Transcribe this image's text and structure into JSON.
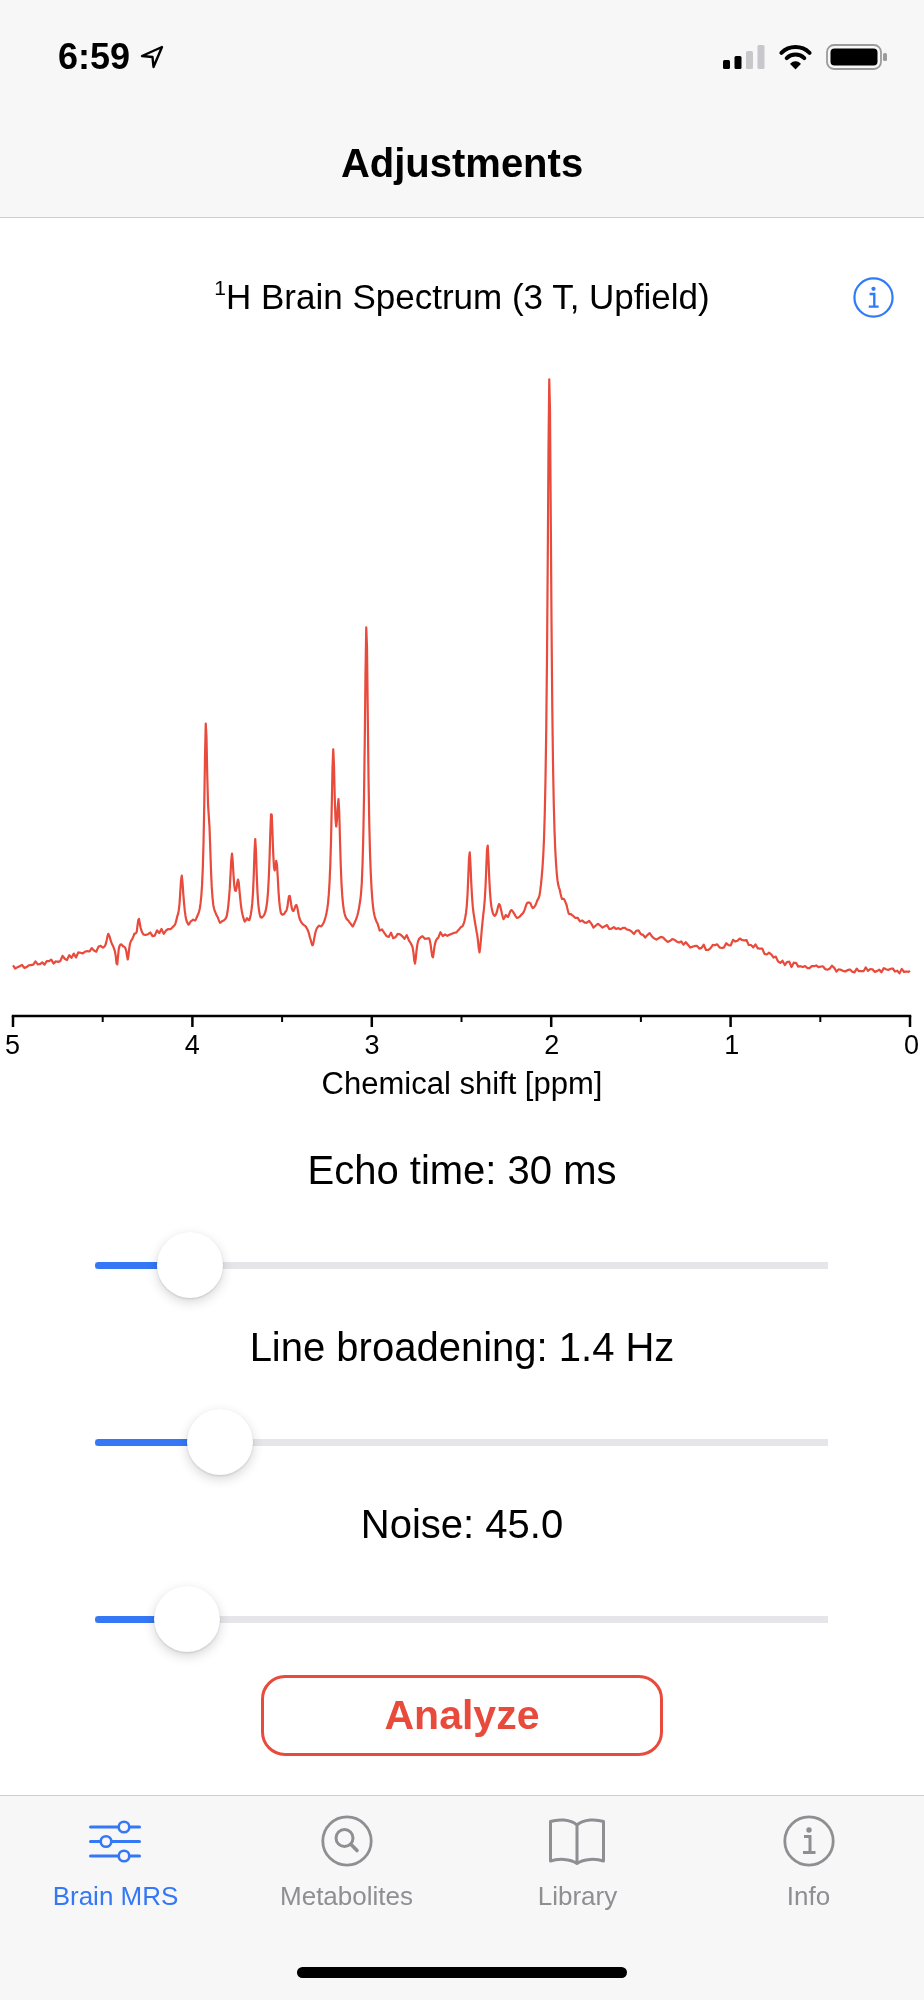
{
  "status_bar": {
    "time": "6:59"
  },
  "nav_bar": {
    "title": "Adjustments"
  },
  "spectrum": {
    "title": "$^{1}$H Brain Spectrum (3 T, Upfield)",
    "tick_labels": [
      "5",
      "4",
      "3",
      "2",
      "1",
      "0"
    ],
    "xlabel": "Chemical shift [ppm]"
  },
  "sliders": [
    {
      "label": "Echo time: 30 ms",
      "level": 0.13
    },
    {
      "label": "Line broadening: 1.4 Hz",
      "level": 0.17
    },
    {
      "label": "Noise: 45.0",
      "level": 0.125
    }
  ],
  "analyze_button": {
    "label": "Analyze"
  },
  "tab_bar": {
    "tabs": [
      {
        "label": "Brain MRS",
        "selected": true
      },
      {
        "label": "Metabolites",
        "selected": false
      },
      {
        "label": "Library",
        "selected": false
      },
      {
        "label": "Info",
        "selected": false
      }
    ]
  }
}
